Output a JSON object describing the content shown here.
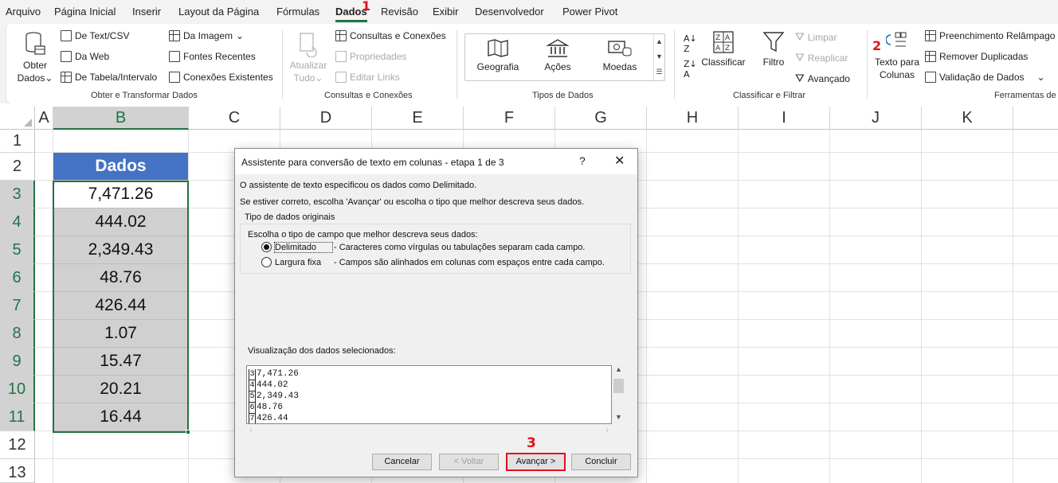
{
  "menu": {
    "tabs": [
      "Arquivo",
      "Página Inicial",
      "Inserir",
      "Layout da Página",
      "Fórmulas",
      "Dados",
      "Revisão",
      "Exibir",
      "Desenvolvedor",
      "Power Pivot"
    ],
    "active": "Dados"
  },
  "markers": {
    "m1": "1",
    "m2": "2",
    "m3": "3"
  },
  "ribbon": {
    "obter_dados": "Obter Dados",
    "obter_dados_l1": "Obter",
    "obter_dados_l2": "Dados",
    "de_text_csv": "De Text/CSV",
    "da_web": "Da Web",
    "de_tabela": "De Tabela/Intervalo",
    "da_imagem": "Da Imagem",
    "fontes_recentes": "Fontes Recentes",
    "conexoes_existentes": "Conexões Existentes",
    "group_obter": "Obter e Transformar Dados",
    "atualizar_l1": "Atualizar",
    "atualizar_l2": "Tudo",
    "consultas_conexoes": "Consultas e Conexões",
    "propriedades": "Propriedades",
    "editar_links": "Editar Links",
    "group_consultas": "Consultas e Conexões",
    "geografia": "Geografia",
    "acoes": "Ações",
    "moedas": "Moedas",
    "group_tipos": "Tipos de Dados",
    "classificar": "Classificar",
    "filtro": "Filtro",
    "limpar": "Limpar",
    "reaplicar": "Reaplicar",
    "avancado": "Avançado",
    "group_classificar": "Classificar e Filtrar",
    "texto_para_l1": "Texto para",
    "texto_para_l2": "Colunas",
    "preenchimento": "Preenchimento Relâmpago",
    "remover_duplicadas": "Remover Duplicadas",
    "validacao": "Validação de Dados",
    "group_ferramentas": "Ferramentas de"
  },
  "sheet": {
    "columns": [
      "A",
      "B",
      "C",
      "D",
      "E",
      "F",
      "G",
      "H",
      "I",
      "J",
      "K"
    ],
    "rows": [
      "1",
      "2",
      "3",
      "4",
      "5",
      "6",
      "7",
      "8",
      "9",
      "10",
      "11",
      "12",
      "13"
    ],
    "header_cell": "Dados",
    "values": [
      "7,471.26",
      "444.02",
      "2,349.43",
      "48.76",
      "426.44",
      "1.07",
      "15.47",
      "20.21",
      "16.44"
    ]
  },
  "dialog": {
    "title": "Assistente para conversão de texto em colunas - etapa 1 de 3",
    "help": "?",
    "close": "✕",
    "line1": "O assistente de texto especificou os dados como Delimitado.",
    "line2": "Se estiver correto, escolha 'Avançar' ou escolha o tipo que melhor descreva seus dados.",
    "group_title": "Tipo de dados originais",
    "choose_text": "Escolha o tipo de campo que melhor descreva seus dados:",
    "opt1_label": "Delimitado",
    "opt1_desc": "- Caracteres como vírgulas ou tabulações separam cada campo.",
    "opt2_label": "Largura fixa",
    "opt2_desc": "- Campos são alinhados em colunas com espaços entre cada campo.",
    "selected_option": "Delimitado",
    "preview_label": "Visualização dos dados selecionados:",
    "preview_lines": [
      {
        "n": "3",
        "text": "7,471.26"
      },
      {
        "n": "4",
        "text": "444.02"
      },
      {
        "n": "5",
        "text": "2,349.43"
      },
      {
        "n": "6",
        "text": "48.76"
      },
      {
        "n": "7",
        "text": "426.44"
      }
    ],
    "btn_cancel": "Cancelar",
    "btn_back": "< Voltar",
    "btn_next": "Avançar >",
    "btn_finish": "Concluir"
  },
  "colors": {
    "accent": "#217346",
    "header_fill": "#4472c4",
    "marker": "#e0101b"
  }
}
